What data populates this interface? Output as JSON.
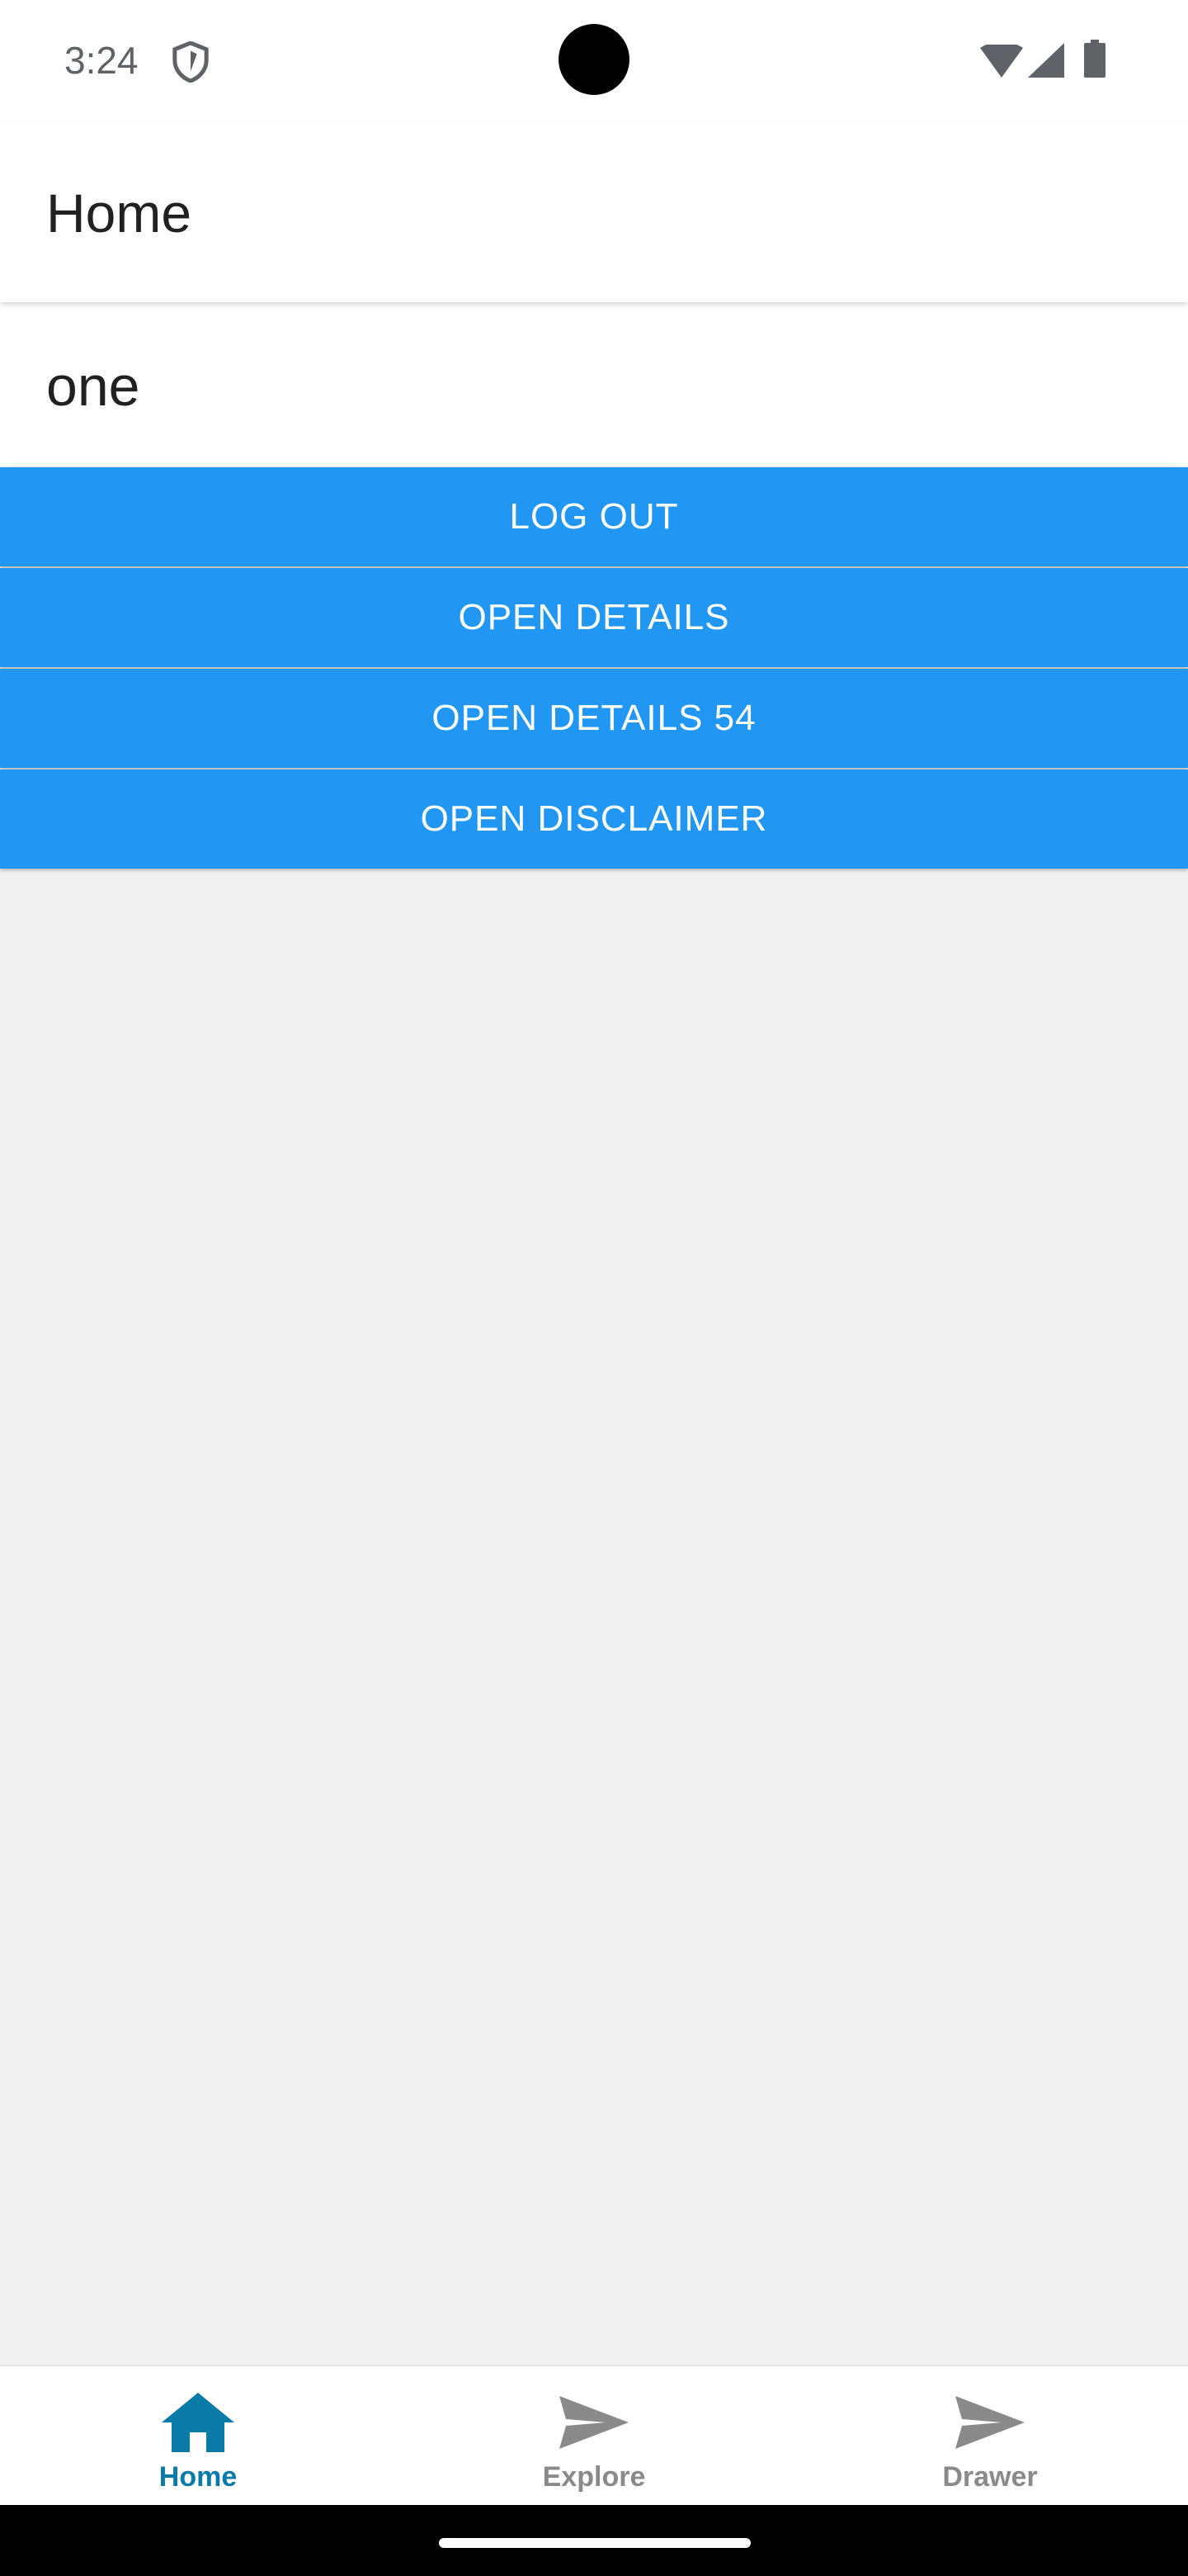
{
  "status_bar": {
    "time": "3:24",
    "icons": [
      "shield-icon",
      "wifi-icon",
      "cell-signal-icon",
      "battery-icon"
    ]
  },
  "app_bar": {
    "title": "Home"
  },
  "content": {
    "title": "one",
    "buttons": {
      "log_out": "LOG OUT",
      "open_details": "OPEN DETAILS",
      "open_details_54": "OPEN DETAILS 54",
      "open_disclaimer": "OPEN DISCLAIMER"
    }
  },
  "tab_bar": {
    "tabs": [
      {
        "label": "Home",
        "icon": "home-icon",
        "selected": true
      },
      {
        "label": "Explore",
        "icon": "send-icon",
        "selected": false
      },
      {
        "label": "Drawer",
        "icon": "send-icon",
        "selected": false
      }
    ]
  },
  "colors": {
    "button": "#2196f3",
    "tab_active": "#0a7aa8",
    "tab_inactive": "#8a8a8a",
    "background": "#f0f0f0"
  }
}
